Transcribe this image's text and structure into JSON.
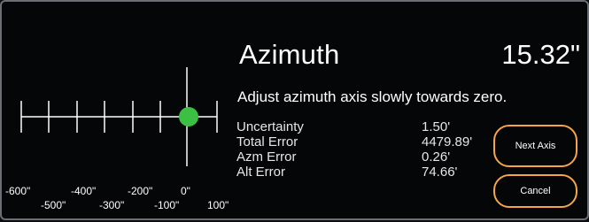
{
  "header": {
    "title": "Azimuth",
    "value": "15.32\""
  },
  "instruction": "Adjust azimuth axis slowly towards zero.",
  "stats": [
    {
      "label": "Uncertainty",
      "value": "1.50'"
    },
    {
      "label": "Total Error",
      "value": "4479.89'"
    },
    {
      "label": "Azm Error",
      "value": "0.26'"
    },
    {
      "label": "Alt Error",
      "value": "74.66'"
    }
  ],
  "buttons": {
    "next_axis": "Next Axis",
    "cancel": "Cancel"
  },
  "scale": {
    "upper_labels": [
      "-600\"",
      "-400\"",
      "-200\"",
      "0\""
    ],
    "lower_labels": [
      "-500\"",
      "-300\"",
      "-100\"",
      "100\""
    ],
    "indicator_color": "#3cc043",
    "accent_color": "#f5a44a"
  }
}
